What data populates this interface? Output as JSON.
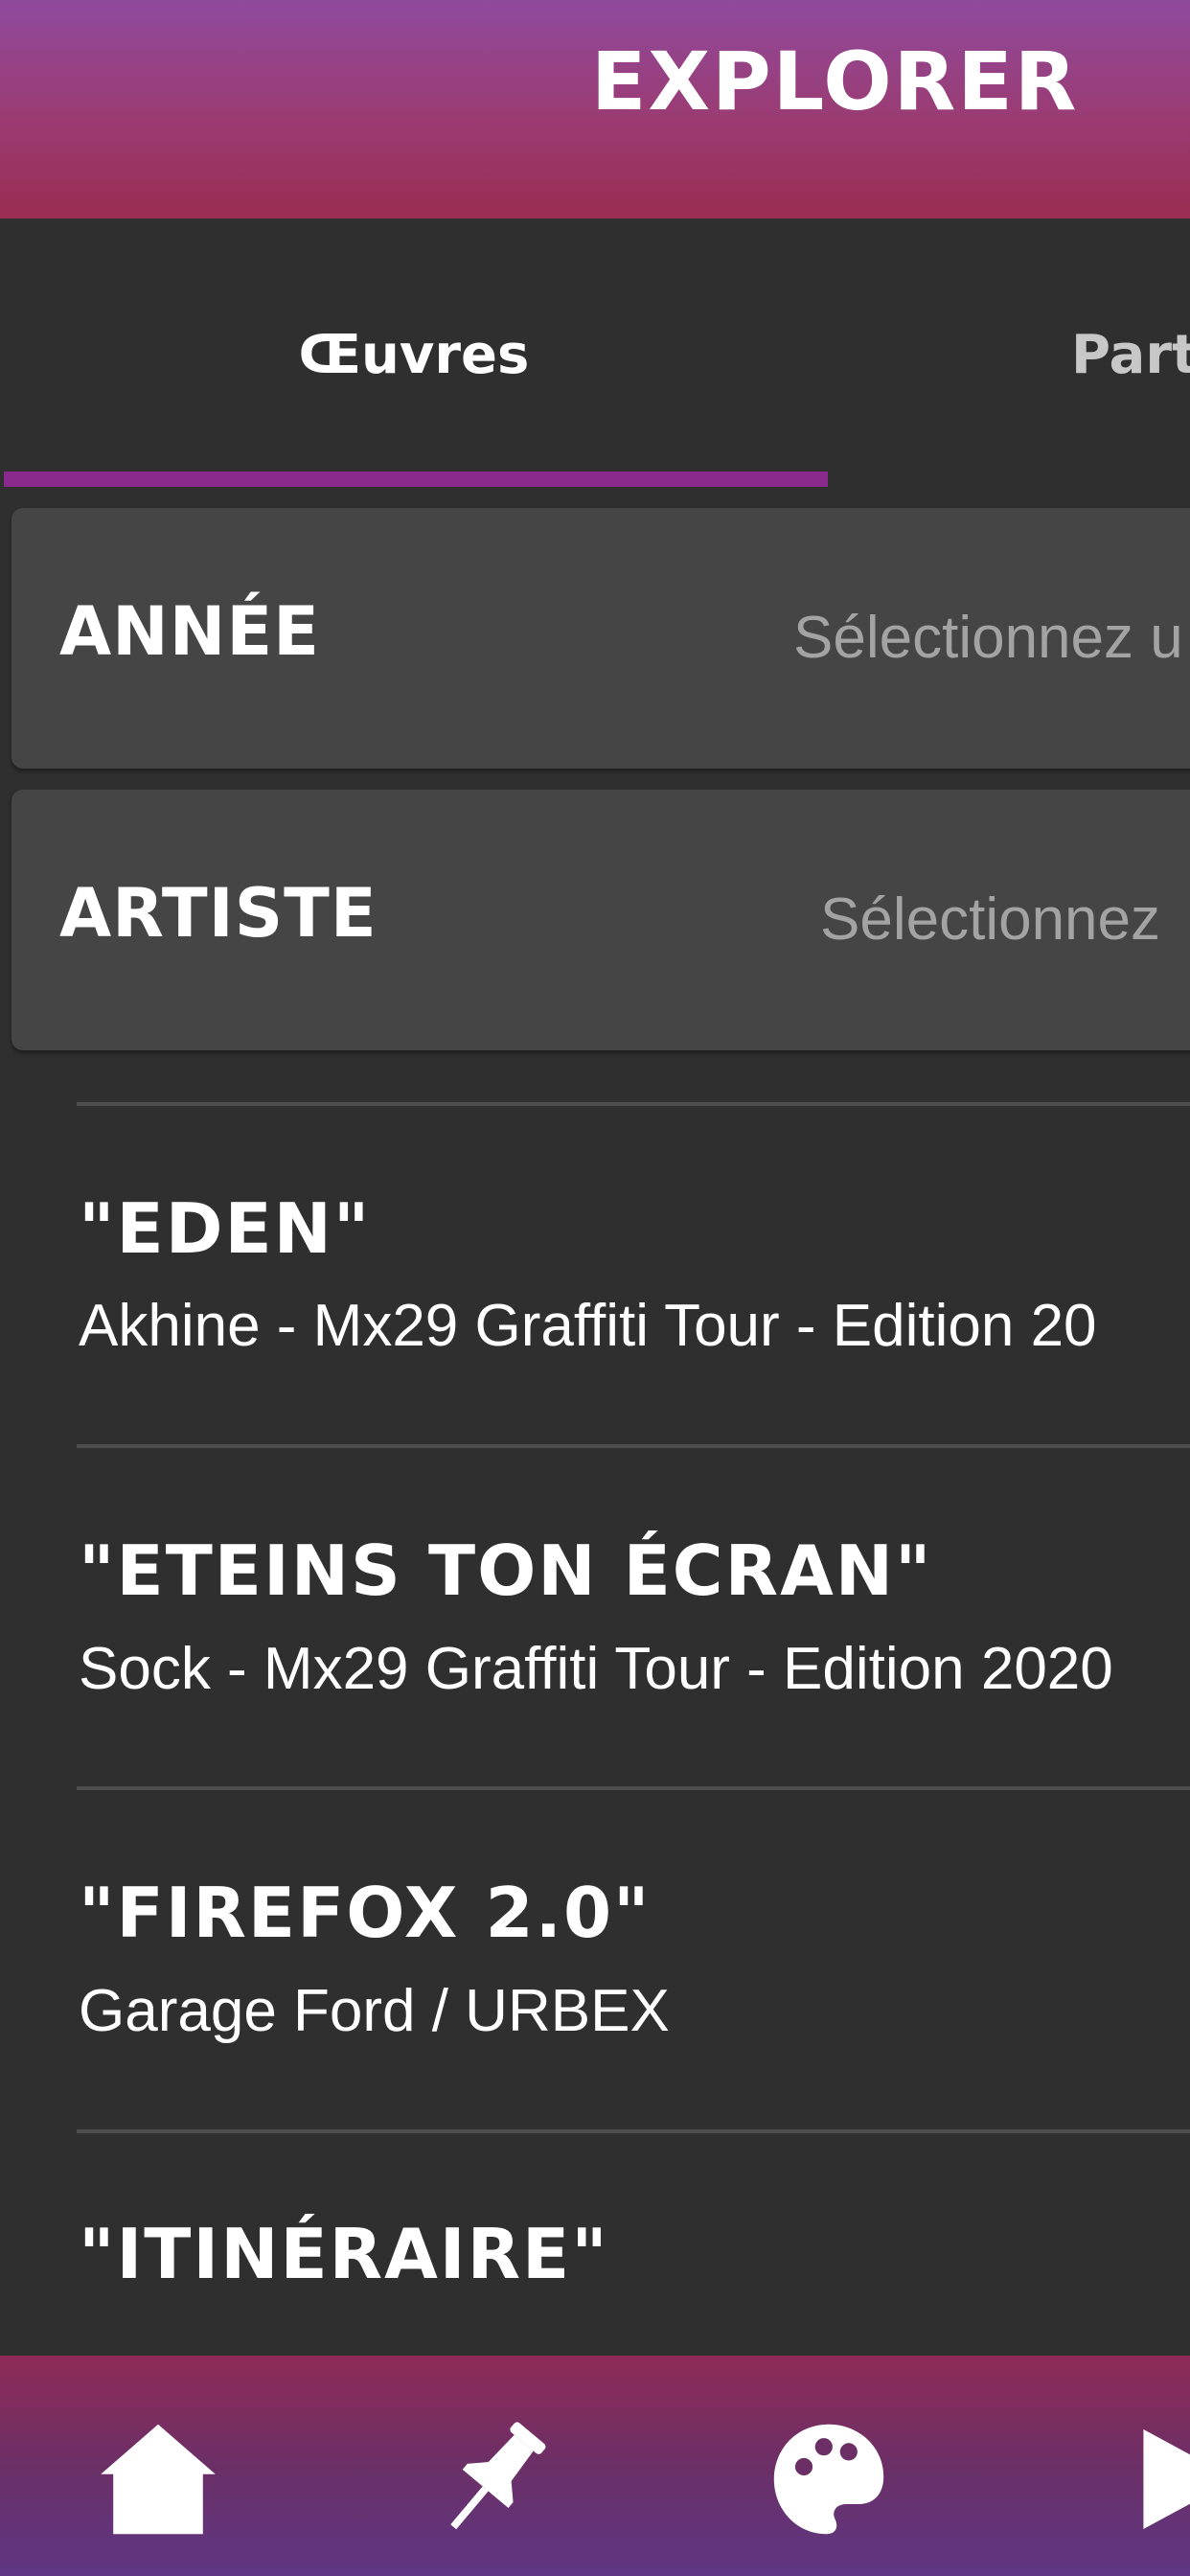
{
  "header": {
    "title": "EXPLORER"
  },
  "tabs": [
    {
      "label": "Œuvres",
      "active": true
    },
    {
      "label": "Part"
    }
  ],
  "filters": {
    "annee": {
      "label": "ANNÉE",
      "placeholder": "Sélectionnez u"
    },
    "artiste": {
      "label": "ARTISTE",
      "placeholder": "Sélectionnez"
    }
  },
  "list": [
    {
      "title": "\"EDEN\"",
      "subtitle": "Akhine - Mx29 Graffiti Tour - Edition 20"
    },
    {
      "title": "\"ETEINS TON ÉCRAN\"",
      "subtitle": "Sock - Mx29 Graffiti Tour - Edition 2020"
    },
    {
      "title": "\"FIREFOX 2.0\"",
      "subtitle": "Garage Ford / URBEX"
    },
    {
      "title": "\"ITINÉRAIRE\""
    }
  ],
  "bottom_nav": {
    "items": [
      {
        "icon": "home-icon"
      },
      {
        "icon": "pin-icon"
      },
      {
        "icon": "palette-icon"
      },
      {
        "icon": "play-icon"
      }
    ]
  },
  "colors": {
    "accent": "#8a2a8c",
    "header_top": "#8f4a9d",
    "header_bottom": "#9a2d52",
    "background": "#2f2f2f",
    "card": "#454545"
  }
}
